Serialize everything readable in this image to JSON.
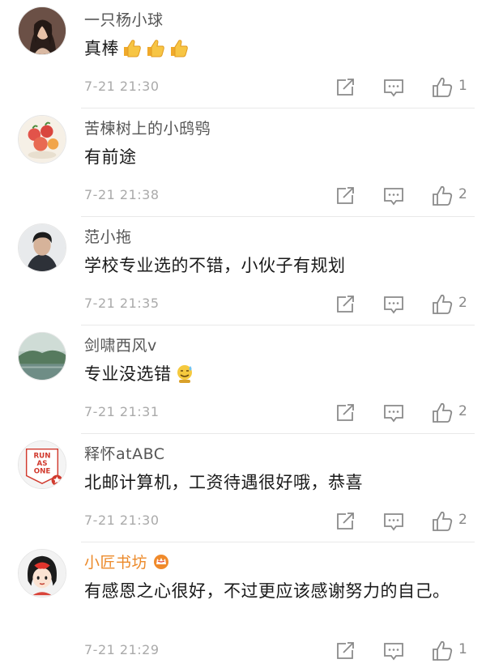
{
  "comments": [
    {
      "username": "一只杨小球",
      "text": "真棒",
      "emojis": [
        "thumbs-up-emoji",
        "thumbs-up-emoji",
        "thumbs-up-emoji"
      ],
      "time": "7-21 21:30",
      "likes": "1",
      "avatar": "avatar-woman-photo"
    },
    {
      "username": "苦楝树上的小鸱鸮",
      "text": "有前途",
      "emojis": [],
      "time": "7-21 21:38",
      "likes": "2",
      "avatar": "avatar-cartoon-fruit"
    },
    {
      "username": "范小拖",
      "text": "学校专业选的不错，小伙子有规划",
      "emojis": [],
      "time": "7-21 21:35",
      "likes": "2",
      "avatar": "avatar-man-photo"
    },
    {
      "username": "剑啸西风v",
      "text": "专业没选错",
      "emojis": [
        "sweat-smile-emoji"
      ],
      "time": "7-21 21:31",
      "likes": "2",
      "avatar": "avatar-landscape-photo"
    },
    {
      "username": "释怀atABC",
      "text": "北邮计算机，工资待遇很好哦，恭喜",
      "emojis": [],
      "time": "7-21 21:30",
      "likes": "2",
      "avatar": "avatar-run-as-one",
      "avatar_text": [
        "RUN",
        "AS",
        "ONE"
      ]
    },
    {
      "username": "小匠书坊",
      "text": "有感恩之心很好，不过更应该感谢努力的自己。",
      "emojis": [],
      "time": "7-21 21:29",
      "likes": "1",
      "avatar": "avatar-cartoon-girl",
      "vip_badge": "crown-badge-icon",
      "username_color": "#ec8a2a"
    }
  ],
  "colors": {
    "username": "#555555",
    "time": "#aaaaaa",
    "icon": "#8a8a8a"
  }
}
